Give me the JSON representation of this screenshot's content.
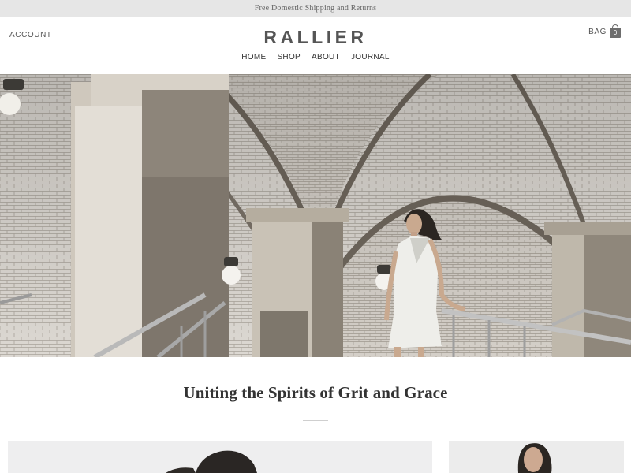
{
  "announcement": {
    "text": "Free Domestic Shipping and Returns"
  },
  "header": {
    "account_label": "ACCOUNT",
    "logo_text": "RALLIER",
    "nav": [
      {
        "label": "HOME"
      },
      {
        "label": "SHOP"
      },
      {
        "label": "ABOUT"
      },
      {
        "label": "JOURNAL"
      }
    ],
    "bag": {
      "label": "BAG",
      "count": "0",
      "icon": "shopping-bag-icon"
    }
  },
  "hero": {
    "image": "model-in-white-dress-on-tiled-vaulted-staircase"
  },
  "intro": {
    "tagline": "Uniting the Spirits of Grit and Grace"
  },
  "tiles": [
    {
      "image": "model-with-dark-hair-light-background"
    },
    {
      "image": "model-portrait-light-background"
    }
  ],
  "colors": {
    "announcement_bg": "#e6e6e6",
    "logo": "#555555",
    "text": "#333333"
  }
}
